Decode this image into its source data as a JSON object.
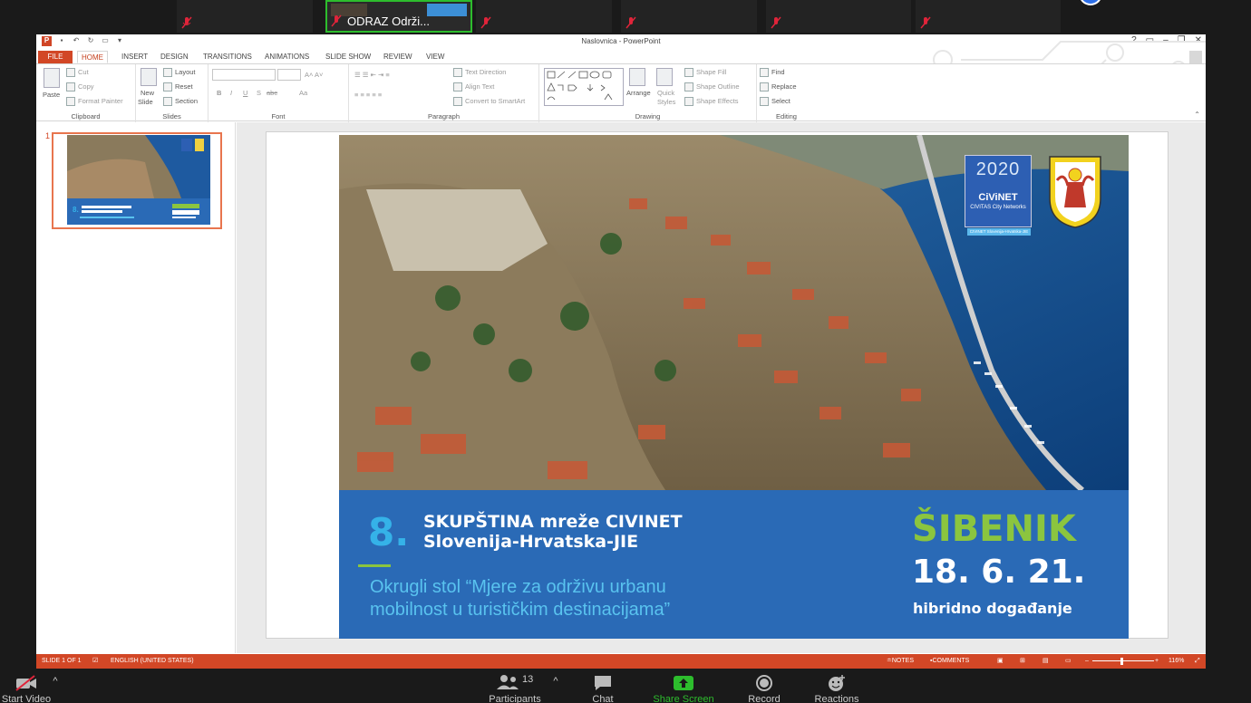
{
  "zoom_top": {
    "active_tile_name": "ODRAZ Održi..."
  },
  "ppt": {
    "window_title": "Naslovnica - PowerPoint",
    "help": "?",
    "tabs": [
      "FILE",
      "HOME",
      "INSERT",
      "DESIGN",
      "TRANSITIONS",
      "ANIMATIONS",
      "SLIDE SHOW",
      "REVIEW",
      "VIEW"
    ],
    "ribbon": {
      "clipboard": {
        "label": "Clipboard",
        "paste": "Paste",
        "cut": "Cut",
        "copy": "Copy",
        "format_painter": "Format Painter"
      },
      "slides": {
        "label": "Slides",
        "new_slide": "New",
        "new_slide2": "Slide",
        "layout": "Layout",
        "reset": "Reset",
        "section": "Section"
      },
      "font": {
        "label": "Font",
        "bold": "B",
        "italic": "I",
        "underline": "U",
        "shadow": "S",
        "strike": "abc",
        "aa": "Aa"
      },
      "paragraph": {
        "label": "Paragraph",
        "text_direction": "Text Direction",
        "align_text": "Align Text",
        "convert": "Convert to SmartArt"
      },
      "drawing": {
        "label": "Drawing",
        "arrange": "Arrange",
        "quick_styles": "Quick",
        "quick_styles2": "Styles",
        "shape_fill": "Shape Fill",
        "shape_outline": "Shape Outline",
        "shape_effects": "Shape Effects"
      },
      "editing": {
        "label": "Editing",
        "find": "Find",
        "replace": "Replace",
        "select": "Select"
      }
    },
    "slide_panel": {
      "number": "1"
    },
    "slide": {
      "number_badge": "8.",
      "heading_line1": "SKUPŠTINA mreže CIVINET",
      "heading_line2": "Slovenija-Hrvatska-JIE",
      "subtitle_line1": "Okrugli stol “Mjere za održivu urbanu",
      "subtitle_line2": "mobilnost u turističkim destinacijama”",
      "city": "ŠIBENIK",
      "date": "18. 6. 21.",
      "event_type": "hibridno događanje",
      "logo_year": "2020",
      "logo_name": "CiViNET",
      "logo_sub": "CIVITAS City Networks",
      "logo_strip": "CIVINET Slovenija-Hrvatska-JIE"
    },
    "statusbar": {
      "slide_of": "SLIDE 1 OF 1",
      "language": "ENGLISH (UNITED STATES)",
      "notes": "NOTES",
      "comments": "COMMENTS",
      "zoom": "116%"
    }
  },
  "zoom_bottom": {
    "video": "Start Video",
    "participants_count": "13",
    "participants": "Participants",
    "chat": "Chat",
    "share": "Share Screen",
    "record": "Record",
    "reactions": "Reactions"
  },
  "colors": {
    "ppt_accent": "#d24726",
    "band_blue": "#2a6ab6",
    "city_green": "#8bc53f",
    "subtitle_blue": "#59c3ef",
    "share_green": "#2dbd2d"
  }
}
